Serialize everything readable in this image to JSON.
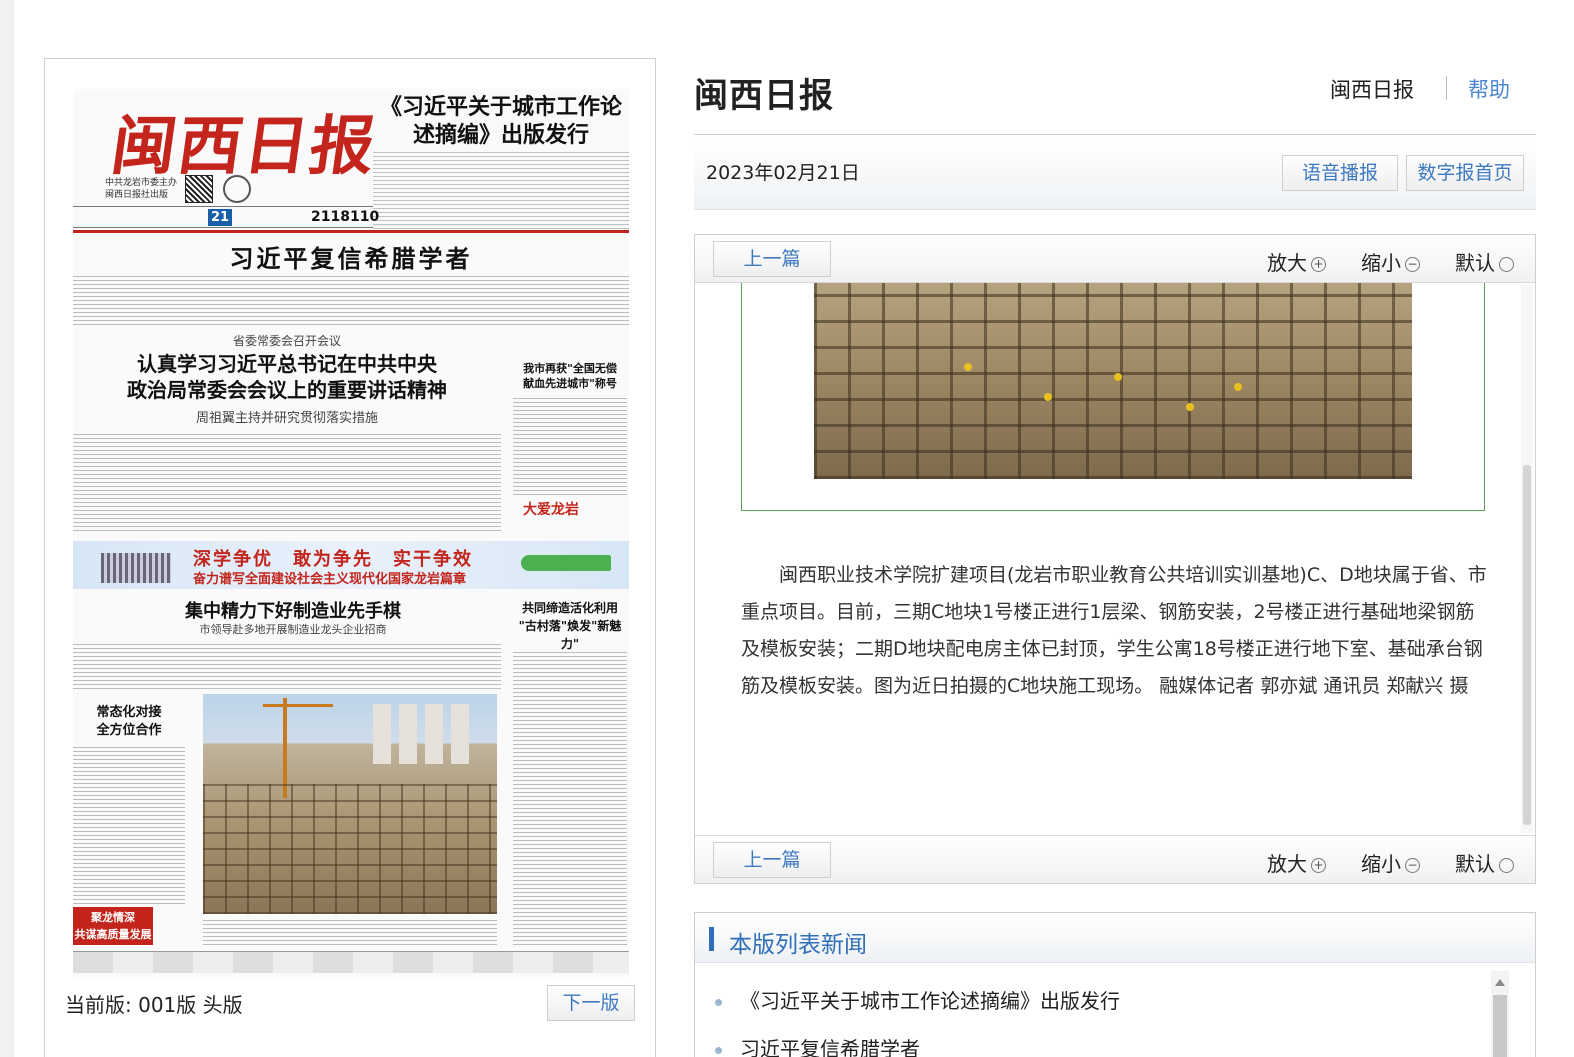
{
  "newspaper": {
    "masthead": "闽西日报",
    "masthead_sub": "中共龙岩市委主办\n闽西日报社出版",
    "lead_headline": "《习近平关于城市工作论述摘编》出版发行",
    "issue_number": "2118110",
    "day_number": "21",
    "headline_main": "习近平复信希腊学者",
    "kicker_1": "省委常委会召开会议",
    "headline_2": "认真学习习近平总书记在中共中央\n政治局常委会会议上的重要讲话精神",
    "sub_2": "周祖翼主持并研究贯彻落实措施",
    "side_headline_1": "我市再获\"全国无偿\n献血先进城市\"称号",
    "banner_line_1": "深学争优　敢为争先　实干争效",
    "banner_line_2": "奋力谱写全面建设社会主义现代化国家龙岩篇章",
    "headline_3": "集中精力下好制造业先手棋",
    "sub_3": "市领导赴多地开展制造业龙头企业招商",
    "side_headline_2": "共同缔造活化利用\n\"古村落\"焕发\"新魅力\"",
    "left_headline": "常态化对接\n全方位合作",
    "red_box": "聚龙情深\n共谋高质量发展",
    "badge": "大爱龙岩"
  },
  "left_panel": {
    "current_edition": "当前版: 001版 头版",
    "next_page": "下一版"
  },
  "header": {
    "brand": "闽西日报",
    "home_link": "闽西日报",
    "help_link": "帮助"
  },
  "date_bar": {
    "date": "2023年02月21日",
    "voice_button": "语音播报",
    "home_button": "数字报首页"
  },
  "article": {
    "prev_button": "上一篇",
    "zoom_in": "放大",
    "zoom_out": "缩小",
    "zoom_default": "默认",
    "caption": "闽西职业技术学院扩建项目(龙岩市职业教育公共培训实训基地)C、D地块属于省、市重点项目。目前，三期C地块1号楼正进行1层梁、钢筋安装，2号楼正进行基础地梁钢筋及模板安装；二期D地块配电房主体已封顶，学生公寓18号楼正进行地下室、基础承台钢筋及模板安装。图为近日拍摄的C地块施工现场。 融媒体记者 郭亦斌 通讯员 郑献兴 摄"
  },
  "list": {
    "title": "本版列表新闻",
    "items": [
      "《习近平关于城市工作论述摘编》出版发行",
      "习近平复信希腊学者"
    ]
  },
  "colors": {
    "accent": "#c3241b",
    "link": "#4a87d0",
    "list_title": "#2f6fb8"
  }
}
